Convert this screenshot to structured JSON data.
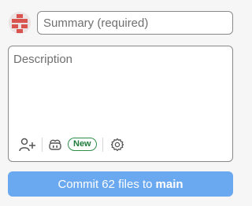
{
  "avatar": {
    "icon": "identicon-avatar",
    "color": "#d9534f"
  },
  "summary": {
    "placeholder": "Summary (required)",
    "value": ""
  },
  "description": {
    "placeholder": "Description",
    "value": ""
  },
  "toolbar": {
    "add_coauthor_icon": "add-person-icon",
    "copilot_icon": "copilot-icon",
    "new_badge": "New",
    "settings_icon": "gear-icon"
  },
  "commit": {
    "prefix": "Commit 62 files to",
    "branch": "main"
  },
  "colors": {
    "accent": "#6aa8f0",
    "badge_green": "#2f8f4a"
  }
}
